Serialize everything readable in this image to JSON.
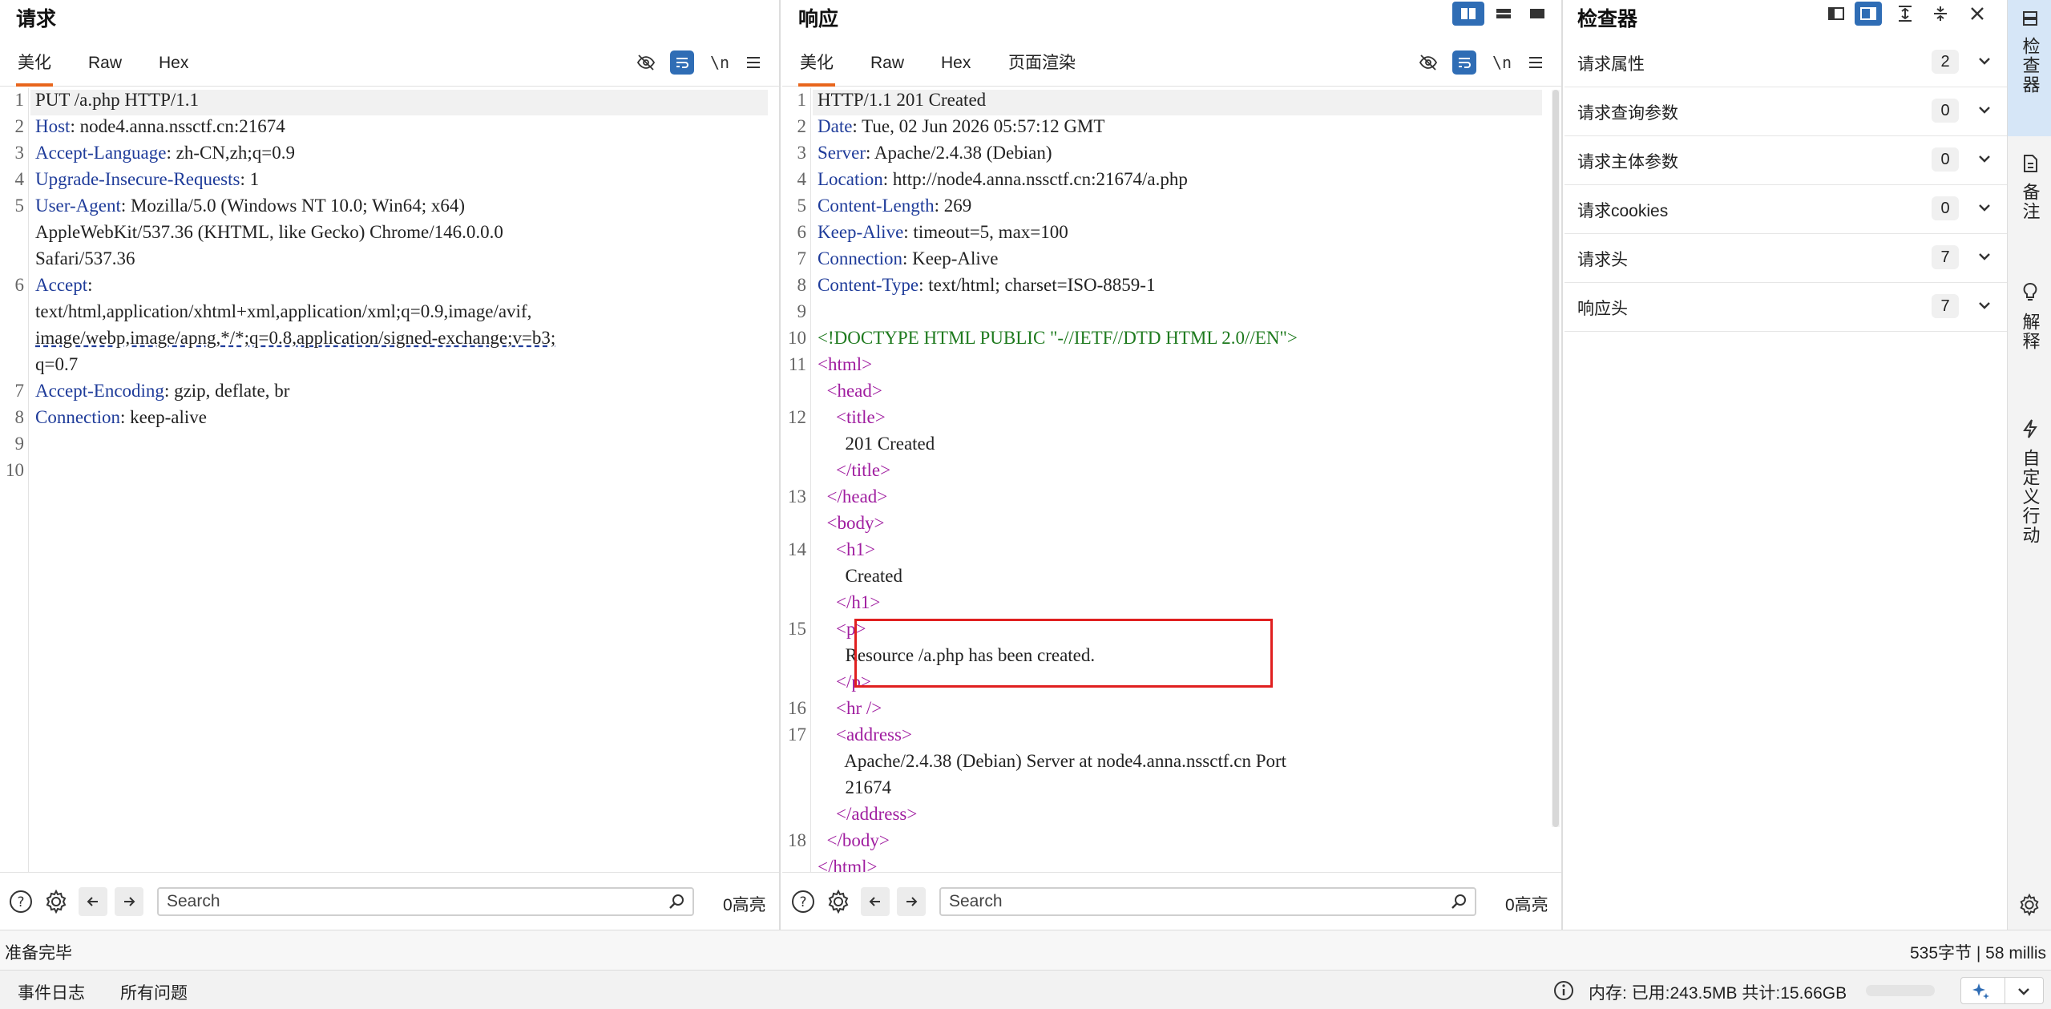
{
  "request": {
    "title": "请求",
    "tabs": [
      "美化",
      "Raw",
      "Hex"
    ],
    "newline_toggle": "\\n",
    "lines": [
      {
        "n": "1",
        "parts": [
          {
            "t": "PUT /a.php HTTP/1.1",
            "c": ""
          }
        ]
      },
      {
        "n": "2",
        "parts": [
          {
            "t": "Host",
            "c": "k"
          },
          {
            "t": ": node4.anna.nssctf.cn:21674",
            "c": ""
          }
        ]
      },
      {
        "n": "3",
        "parts": [
          {
            "t": "Accept-Language",
            "c": "k"
          },
          {
            "t": ": zh-CN,zh;q=0.9",
            "c": ""
          }
        ]
      },
      {
        "n": "4",
        "parts": [
          {
            "t": "Upgrade-Insecure-Requests",
            "c": "k"
          },
          {
            "t": ": 1",
            "c": ""
          }
        ]
      },
      {
        "n": "5",
        "parts": [
          {
            "t": "User-Agent",
            "c": "k"
          },
          {
            "t": ": Mozilla/5.0 (Windows NT 10.0; Win64; x64)",
            "c": ""
          }
        ]
      },
      {
        "n": "",
        "parts": [
          {
            "t": "AppleWebKit/537.36 (KHTML, like Gecko) Chrome/146.0.0.0",
            "c": ""
          }
        ]
      },
      {
        "n": "",
        "parts": [
          {
            "t": "Safari/537.36",
            "c": ""
          }
        ]
      },
      {
        "n": "6",
        "parts": [
          {
            "t": "Accept",
            "c": "k"
          },
          {
            "t": ":",
            "c": ""
          }
        ]
      },
      {
        "n": "",
        "parts": [
          {
            "t": "text/html,application/xhtml+xml,application/xml;q=0.9,image/avif,",
            "c": ""
          }
        ]
      },
      {
        "n": "",
        "parts": [
          {
            "t": "image/webp,image/apng,*/*;q=0.8,application/signed-exchange;v=b3;",
            "c": ""
          }
        ]
      },
      {
        "n": "",
        "parts": [
          {
            "t": "q=0.7",
            "c": ""
          }
        ]
      },
      {
        "n": "7",
        "parts": [
          {
            "t": "Accept-Encoding",
            "c": "k"
          },
          {
            "t": ": gzip, deflate, br",
            "c": ""
          }
        ]
      },
      {
        "n": "8",
        "parts": [
          {
            "t": "Connection",
            "c": "k"
          },
          {
            "t": ": keep-alive",
            "c": ""
          }
        ]
      },
      {
        "n": "9",
        "parts": []
      },
      {
        "n": "10",
        "parts": []
      }
    ],
    "search_placeholder": "Search",
    "highlight_count": "0高亮"
  },
  "response": {
    "title": "响应",
    "tabs": [
      "美化",
      "Raw",
      "Hex",
      "页面渲染"
    ],
    "newline_toggle": "\\n",
    "lines": [
      {
        "n": "1",
        "parts": [
          {
            "t": "HTTP/1.1 201 Created",
            "c": ""
          }
        ]
      },
      {
        "n": "2",
        "parts": [
          {
            "t": "Date",
            "c": "k"
          },
          {
            "t": ": Tue, 02 Jun 2026 05:57:12 GMT",
            "c": ""
          }
        ]
      },
      {
        "n": "3",
        "parts": [
          {
            "t": "Server",
            "c": "k"
          },
          {
            "t": ": Apache/2.4.38 (Debian)",
            "c": ""
          }
        ]
      },
      {
        "n": "4",
        "parts": [
          {
            "t": "Location",
            "c": "k"
          },
          {
            "t": ": http://node4.anna.nssctf.cn:21674/a.php",
            "c": ""
          }
        ]
      },
      {
        "n": "5",
        "parts": [
          {
            "t": "Content-Length",
            "c": "k"
          },
          {
            "t": ": 269",
            "c": ""
          }
        ]
      },
      {
        "n": "6",
        "parts": [
          {
            "t": "Keep-Alive",
            "c": "k"
          },
          {
            "t": ": timeout=5, max=100",
            "c": ""
          }
        ]
      },
      {
        "n": "7",
        "parts": [
          {
            "t": "Connection",
            "c": "k"
          },
          {
            "t": ": Keep-Alive",
            "c": ""
          }
        ]
      },
      {
        "n": "8",
        "parts": [
          {
            "t": "Content-Type",
            "c": "k"
          },
          {
            "t": ": text/html; charset=ISO-8859-1",
            "c": ""
          }
        ]
      },
      {
        "n": "9",
        "parts": []
      },
      {
        "n": "10",
        "parts": [
          {
            "t": "<!DOCTYPE HTML PUBLIC \"-//IETF//DTD HTML 2.0//EN\">",
            "c": "dc"
          }
        ]
      },
      {
        "n": "11",
        "parts": [
          {
            "t": "<html>",
            "c": "tg"
          }
        ]
      },
      {
        "n": "",
        "parts": [
          {
            "t": "  <head>",
            "c": "tg"
          }
        ]
      },
      {
        "n": "12",
        "parts": [
          {
            "t": "    <title>",
            "c": "tg"
          }
        ]
      },
      {
        "n": "",
        "parts": [
          {
            "t": "      201 Created",
            "c": ""
          }
        ]
      },
      {
        "n": "",
        "parts": [
          {
            "t": "    </title>",
            "c": "tg"
          }
        ]
      },
      {
        "n": "13",
        "parts": [
          {
            "t": "  </head>",
            "c": "tg"
          }
        ]
      },
      {
        "n": "",
        "parts": [
          {
            "t": "  <body>",
            "c": "tg"
          }
        ]
      },
      {
        "n": "14",
        "parts": [
          {
            "t": "    <h1>",
            "c": "tg"
          }
        ]
      },
      {
        "n": "",
        "parts": [
          {
            "t": "      Created",
            "c": ""
          }
        ]
      },
      {
        "n": "",
        "parts": [
          {
            "t": "    </h1>",
            "c": "tg"
          }
        ]
      },
      {
        "n": "15",
        "parts": [
          {
            "t": "    <p>",
            "c": "tg"
          }
        ]
      },
      {
        "n": "",
        "parts": [
          {
            "t": "      Resource /a.php has been created.",
            "c": ""
          }
        ]
      },
      {
        "n": "",
        "parts": [
          {
            "t": "    </p>",
            "c": "tg"
          }
        ]
      },
      {
        "n": "16",
        "parts": [
          {
            "t": "    <hr />",
            "c": "tg"
          }
        ]
      },
      {
        "n": "17",
        "parts": [
          {
            "t": "    <address>",
            "c": "tg"
          }
        ]
      },
      {
        "n": "",
        "parts": [
          {
            "t": "      Apache/2.4.38 (Debian) Server at node4.anna.nssctf.cn Port",
            "c": ""
          }
        ]
      },
      {
        "n": "",
        "parts": [
          {
            "t": "      21674",
            "c": ""
          }
        ]
      },
      {
        "n": "",
        "parts": [
          {
            "t": "    </address>",
            "c": "tg"
          }
        ]
      },
      {
        "n": "18",
        "parts": [
          {
            "t": "  </body>",
            "c": "tg"
          }
        ]
      },
      {
        "n": "",
        "parts": [
          {
            "t": "</html>",
            "c": "tg"
          }
        ]
      }
    ],
    "search_placeholder": "Search",
    "highlight_count": "0高亮"
  },
  "inspector": {
    "title": "检查器",
    "rows": [
      {
        "label": "请求属性",
        "count": "2"
      },
      {
        "label": "请求查询参数",
        "count": "0"
      },
      {
        "label": "请求主体参数",
        "count": "0"
      },
      {
        "label": "请求cookies",
        "count": "0"
      },
      {
        "label": "请求头",
        "count": "7"
      },
      {
        "label": "响应头",
        "count": "7"
      }
    ]
  },
  "side_tabs": [
    "检查器",
    "备注",
    "解释",
    "自定义行动"
  ],
  "status": {
    "left": "准备完毕",
    "right": "535字节 | 58 millis"
  },
  "footer": {
    "event_log": "事件日志",
    "all_issues": "所有问题",
    "memory": "内存: 已用:243.5MB 共计:15.66GB"
  },
  "colors": {
    "accent_tab": "#e8651c",
    "header_key": "#1f3c9a",
    "html_tag": "#a01ea0",
    "doctype": "#1e7a1e",
    "annotation_box": "#e02020",
    "toggle_active": "#2f6db5"
  }
}
